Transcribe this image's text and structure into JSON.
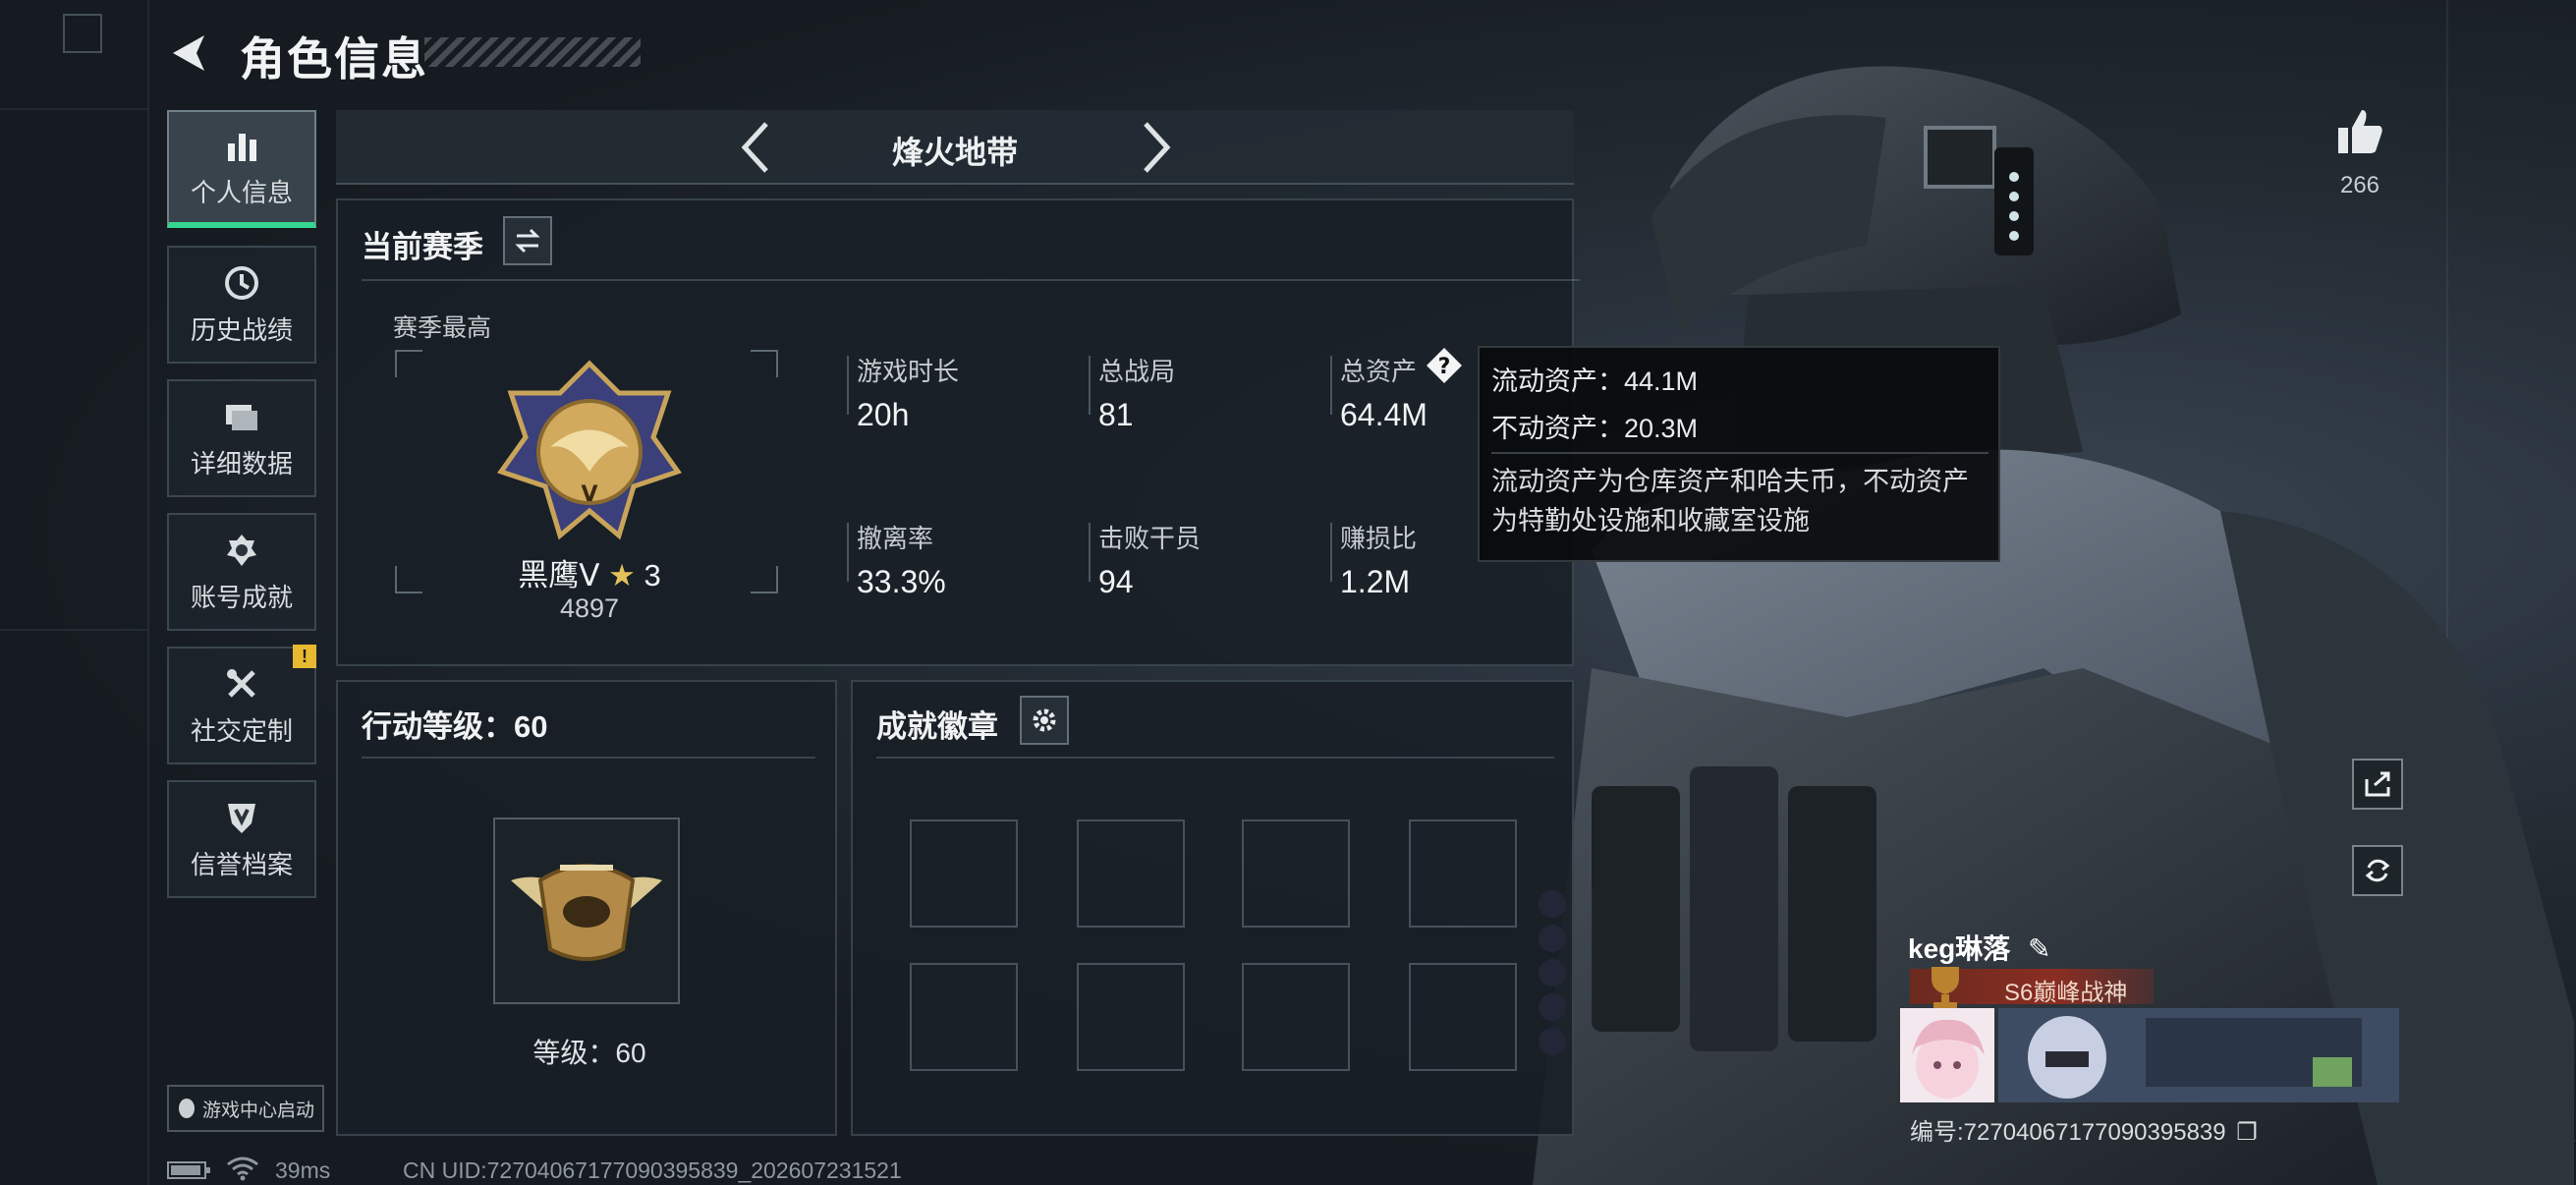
{
  "header": {
    "title": "角色信息"
  },
  "nav": {
    "items": [
      {
        "label": "个人信息",
        "icon": "bar-chart-icon",
        "active": true
      },
      {
        "label": "历史战绩",
        "icon": "clock-history-icon",
        "active": false
      },
      {
        "label": "详细数据",
        "icon": "folders-icon",
        "active": false
      },
      {
        "label": "账号成就",
        "icon": "medal-icon",
        "active": false
      },
      {
        "label": "社交定制",
        "icon": "tools-icon",
        "active": false,
        "badge": "!"
      },
      {
        "label": "信誉档案",
        "icon": "shield-icon",
        "active": false
      }
    ],
    "launch_label": "游戏中心启动"
  },
  "mode": {
    "label": "烽火地带"
  },
  "season": {
    "title": "当前赛季",
    "best_label": "赛季最高",
    "rank_name": "黑鹰Ⅴ",
    "rank_stars": "3",
    "rank_score": "4897",
    "stats": [
      {
        "label": "游戏时长",
        "value": "20h"
      },
      {
        "label": "总战局",
        "value": "81"
      },
      {
        "label": "总资产",
        "value": "64.4M"
      },
      {
        "label": "撤离率",
        "value": "33.3%"
      },
      {
        "label": "击败干员",
        "value": "94"
      },
      {
        "label": "赚损比",
        "value": "1.2M"
      }
    ]
  },
  "tooltip": {
    "liquid": "流动资产：44.1M",
    "fixed": "不动资产：20.3M",
    "description": "流动资产为仓库资产和哈夫币，不动资产为特勤处设施和收藏室设施"
  },
  "level": {
    "title": "行动等级：60",
    "label": "等级：60"
  },
  "achievements": {
    "title": "成就徽章"
  },
  "profile": {
    "likes": "266",
    "player_name": "keg琳落",
    "title": "S6巅峰战神",
    "uid": "编号:7270406717709039583​9"
  },
  "footer": {
    "ping": "39ms",
    "uid": "CN UID:7270406717709039583​9_202607231521"
  },
  "colors": {
    "accent": "#35d68f",
    "badge": "#e7b931",
    "title_bar": "#8a2d22"
  }
}
